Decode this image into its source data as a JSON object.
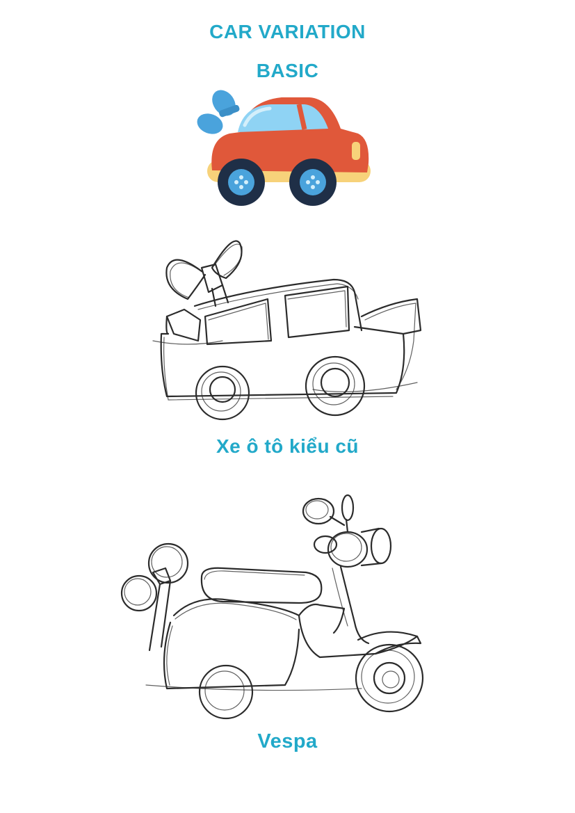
{
  "header": {
    "title": "CAR VARIATION",
    "subtitle": "BASIC"
  },
  "illustrations": [
    {
      "icon": "toy-car-icon",
      "caption": ""
    },
    {
      "icon": "old-car-sketch-icon",
      "caption": "Xe ô tô kiểu cũ"
    },
    {
      "icon": "vespa-sketch-icon",
      "caption": "Vespa"
    }
  ],
  "colors": {
    "heading": "#22a9c9",
    "car_body": "#e0583a",
    "car_window": "#8fd3f4",
    "car_wing": "#4aa3dc",
    "car_bumper": "#f7d27a",
    "wheel": "#1f2f47",
    "hub": "#4aa3dc"
  }
}
